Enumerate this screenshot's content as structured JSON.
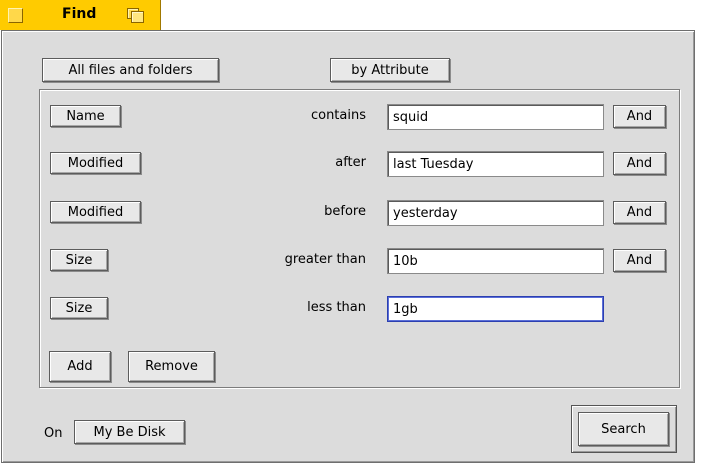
{
  "window": {
    "title": "Find"
  },
  "top": {
    "scope_button": "All files and folders",
    "mode_button": "by Attribute"
  },
  "criteria": [
    {
      "attribute": "Name",
      "operator": "contains",
      "value": "squid",
      "conjunction": "And"
    },
    {
      "attribute": "Modified",
      "operator": "after",
      "value": "last Tuesday",
      "conjunction": "And"
    },
    {
      "attribute": "Modified",
      "operator": "before",
      "value": "yesterday",
      "conjunction": "And"
    },
    {
      "attribute": "Size",
      "operator": "greater than",
      "value": "10b",
      "conjunction": "And"
    },
    {
      "attribute": "Size",
      "operator": "less than",
      "value": "1gb",
      "conjunction": ""
    }
  ],
  "panel": {
    "add_button": "Add",
    "remove_button": "Remove"
  },
  "bottom": {
    "on_label": "On",
    "volume_button": "My Be Disk",
    "search_button": "Search"
  },
  "colors": {
    "tab": "#ffcb00",
    "window": "#dcdcdc",
    "focus_border": "#2c3fb0"
  }
}
